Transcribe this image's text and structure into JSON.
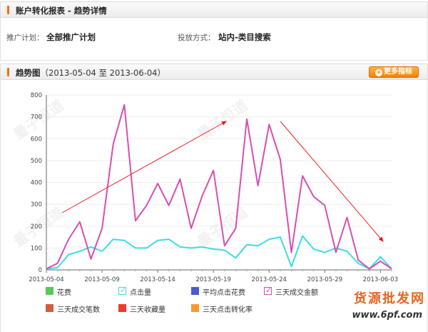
{
  "header": {
    "title": "账户转化报表 - 趋势详情"
  },
  "info": {
    "plan_label": "推广计划：",
    "plan_value": "全部推广计划",
    "method_label": "投放方式：",
    "method_value": "站内-类目搜索"
  },
  "trend": {
    "title": "趋势图",
    "range": "（2013-05-04 至 2013-06-04）",
    "more_button": "更多指标"
  },
  "colors": {
    "accent": "#ff6a00",
    "series_pink": "#d94db2",
    "series_cyan": "#3bdde3"
  },
  "chart_data": {
    "type": "line",
    "ylim": [
      0,
      800
    ],
    "y_ticks": [
      "0",
      "100",
      "200",
      "300",
      "400",
      "500",
      "600",
      "700",
      "800"
    ],
    "x_tick_labels": [
      "2013-05-04",
      "2013-05-09",
      "2013-05-14",
      "2013-05-19",
      "2013-05-24",
      "2013-05-29",
      "2013-06-03"
    ],
    "x": [
      "2013-05-04",
      "2013-05-05",
      "2013-05-06",
      "2013-05-07",
      "2013-05-08",
      "2013-05-09",
      "2013-05-10",
      "2013-05-11",
      "2013-05-12",
      "2013-05-13",
      "2013-05-14",
      "2013-05-15",
      "2013-05-16",
      "2013-05-17",
      "2013-05-18",
      "2013-05-19",
      "2013-05-20",
      "2013-05-21",
      "2013-05-22",
      "2013-05-23",
      "2013-05-24",
      "2013-05-25",
      "2013-05-26",
      "2013-05-27",
      "2013-05-28",
      "2013-05-29",
      "2013-05-30",
      "2013-05-31",
      "2013-06-01",
      "2013-06-02",
      "2013-06-03",
      "2013-06-04"
    ],
    "series": [
      {
        "name": "三天成交金额",
        "color": "#d94db2",
        "values": [
          5,
          30,
          140,
          220,
          50,
          190,
          575,
          755,
          225,
          295,
          395,
          295,
          415,
          190,
          340,
          455,
          110,
          190,
          690,
          385,
          665,
          505,
          80,
          430,
          335,
          295,
          80,
          240,
          45,
          5,
          40,
          5
        ]
      },
      {
        "name": "点击量",
        "color": "#3bdde3",
        "values": [
          5,
          10,
          70,
          85,
          105,
          85,
          140,
          135,
          100,
          100,
          135,
          140,
          105,
          100,
          105,
          95,
          90,
          55,
          115,
          110,
          140,
          150,
          15,
          155,
          95,
          80,
          100,
          85,
          30,
          5,
          60,
          5
        ]
      }
    ]
  },
  "legend": [
    {
      "label": "花费",
      "color": "#58c85a",
      "checked": false
    },
    {
      "label": "点击量",
      "color": "#3bdde3",
      "checked": true
    },
    {
      "label": "平均点击花费",
      "color": "#4a57d6",
      "checked": false
    },
    {
      "label": "三天成交金额",
      "color": "#d94db2",
      "checked": true
    },
    {
      "label": "三天成交笔数",
      "color": "#d35a43",
      "checked": false
    },
    {
      "label": "三天收藏量",
      "color": "#ee3a2e",
      "checked": false
    },
    {
      "label": "三天点击转化率",
      "color": "#f79a2c",
      "checked": false
    }
  ],
  "watermark": {
    "site_name": "货源批发网",
    "site_url": "www.6pf.com",
    "logo_text": "量子恒道"
  },
  "icons": {
    "more_plus": "plus-icon",
    "check": "checkmark-icon"
  }
}
